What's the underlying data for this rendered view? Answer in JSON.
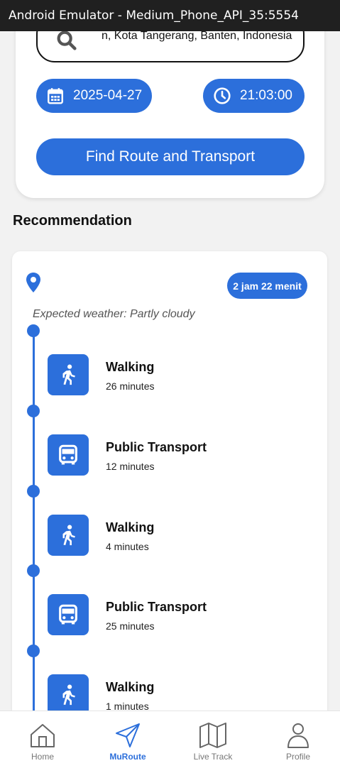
{
  "window": {
    "title": "Android Emulator - Medium_Phone_API_35:5554"
  },
  "search": {
    "value": "n, Kota Tangerang, Banten, Indonesia",
    "date": "2025-04-27",
    "time": "21:03:00",
    "find_label": "Find Route and Transport"
  },
  "recommendation": {
    "title": "Recommendation",
    "duration": "2 jam 22 menit",
    "weather": "Expected weather: Partly cloudy",
    "steps": [
      {
        "title": "Walking",
        "duration": "26 minutes",
        "icon": "walking-icon"
      },
      {
        "title": "Public Transport",
        "duration": "12 minutes",
        "icon": "bus-icon"
      },
      {
        "title": "Walking",
        "duration": "4 minutes",
        "icon": "walking-icon"
      },
      {
        "title": "Public Transport",
        "duration": "25 minutes",
        "icon": "bus-icon"
      },
      {
        "title": "Walking",
        "duration": "1 minutes",
        "icon": "walking-icon"
      }
    ]
  },
  "nav": {
    "items": [
      {
        "label": "Home",
        "icon": "home-icon",
        "active": false
      },
      {
        "label": "MuRoute",
        "icon": "navigation-arrow-icon",
        "active": true
      },
      {
        "label": "Live Track",
        "icon": "map-icon",
        "active": false
      },
      {
        "label": "Profile",
        "icon": "person-icon",
        "active": false
      }
    ]
  },
  "colors": {
    "accent": "#2c6fdb",
    "background": "#f2f2f2",
    "titlebar": "#202020"
  }
}
